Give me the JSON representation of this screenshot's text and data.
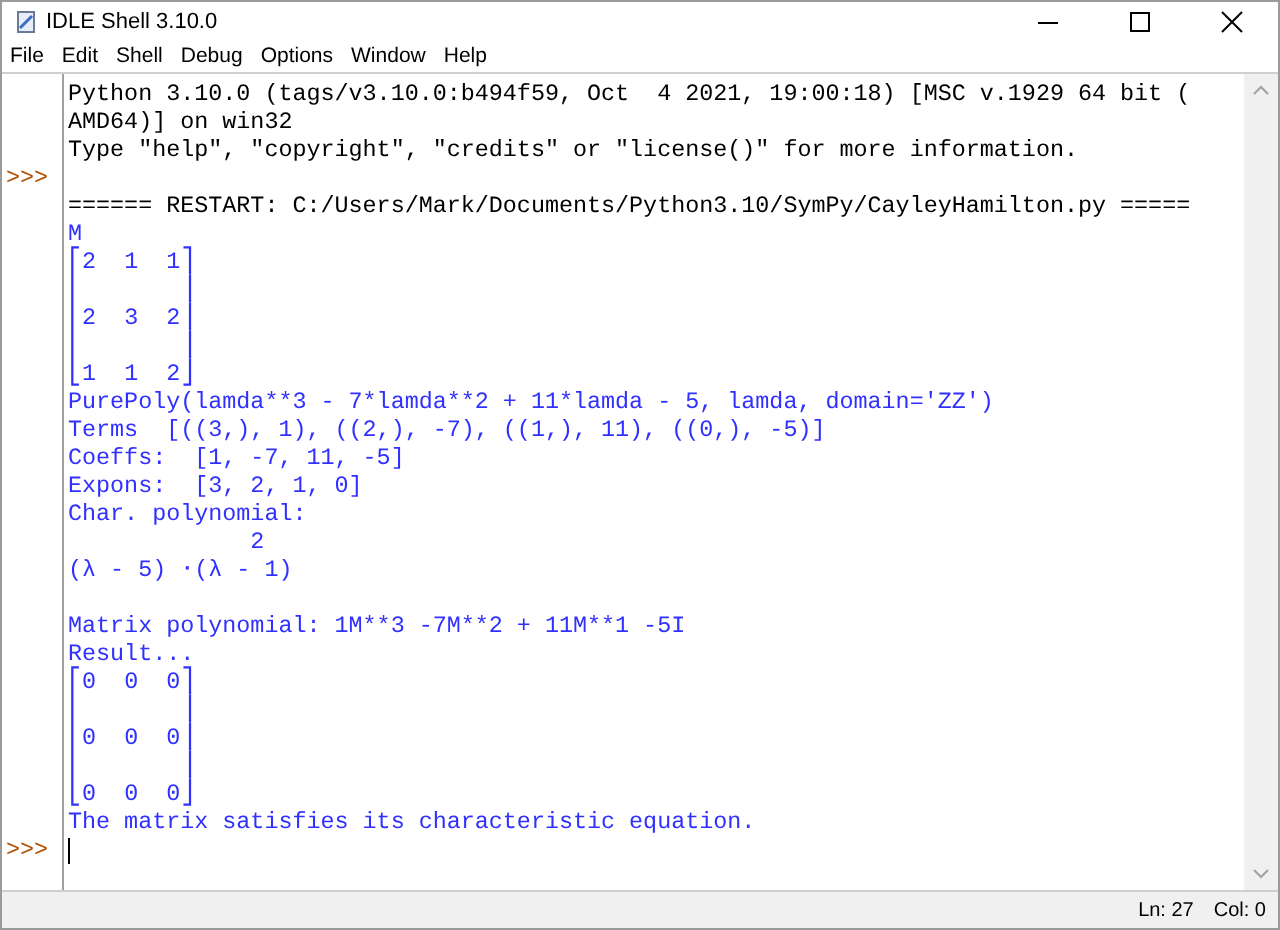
{
  "window": {
    "title": "IDLE Shell 3.10.0"
  },
  "menu": [
    {
      "label": "File"
    },
    {
      "label": "Edit"
    },
    {
      "label": "Shell"
    },
    {
      "label": "Debug"
    },
    {
      "label": "Options"
    },
    {
      "label": "Window"
    },
    {
      "label": "Help"
    }
  ],
  "lines": [
    {
      "kind": "console",
      "text": "Python 3.10.0 (tags/v3.10.0:b494f59, Oct  4 2021, 19:00:18) [MSC v.1929 64 bit ("
    },
    {
      "kind": "console",
      "text": "AMD64)] on win32"
    },
    {
      "kind": "console",
      "text": "Type \"help\", \"copyright\", \"credits\" or \"license()\" for more information."
    },
    {
      "kind": "blank",
      "prompt": ">>>"
    },
    {
      "kind": "console",
      "text": "====== RESTART: C:/Users/Mark/Documents/Python3.10/SymPy/CayleyHamilton.py ====="
    },
    {
      "kind": "stdout",
      "text": "M"
    },
    {
      "kind": "stdout",
      "text": "⎡2  1  1⎤"
    },
    {
      "kind": "stdout",
      "text": "⎢       ⎥"
    },
    {
      "kind": "stdout",
      "text": "⎢2  3  2⎥"
    },
    {
      "kind": "stdout",
      "text": "⎢       ⎥"
    },
    {
      "kind": "stdout",
      "text": "⎣1  1  2⎦"
    },
    {
      "kind": "stdout",
      "text": "PurePoly(lamda**3 - 7*lamda**2 + 11*lamda - 5, lamda, domain='ZZ')"
    },
    {
      "kind": "stdout",
      "text": "Terms  [((3,), 1), ((2,), -7), ((1,), 11), ((0,), -5)]"
    },
    {
      "kind": "stdout",
      "text": "Coeffs:  [1, -7, 11, -5]"
    },
    {
      "kind": "stdout",
      "text": "Expons:  [3, 2, 1, 0]"
    },
    {
      "kind": "stdout",
      "text": "Char. polynomial:"
    },
    {
      "kind": "stdout",
      "text": "             2"
    },
    {
      "kind": "stdout",
      "text": "(λ - 5) ⋅(λ - 1)"
    },
    {
      "kind": "blank"
    },
    {
      "kind": "stdout",
      "text": "Matrix polynomial: 1M**3 -7M**2 + 11M**1 -5I"
    },
    {
      "kind": "stdout",
      "text": "Result..."
    },
    {
      "kind": "stdout",
      "text": "⎡0  0  0⎤"
    },
    {
      "kind": "stdout",
      "text": "⎢       ⎥"
    },
    {
      "kind": "stdout",
      "text": "⎢0  0  0⎥"
    },
    {
      "kind": "stdout",
      "text": "⎢       ⎥"
    },
    {
      "kind": "stdout",
      "text": "⎣0  0  0⎦"
    },
    {
      "kind": "stdout",
      "text": "The matrix satisfies its characteristic equation."
    },
    {
      "kind": "input",
      "prompt": ">>>"
    }
  ],
  "status_bar": {
    "line": "Ln: 27",
    "column": "Col: 0"
  }
}
